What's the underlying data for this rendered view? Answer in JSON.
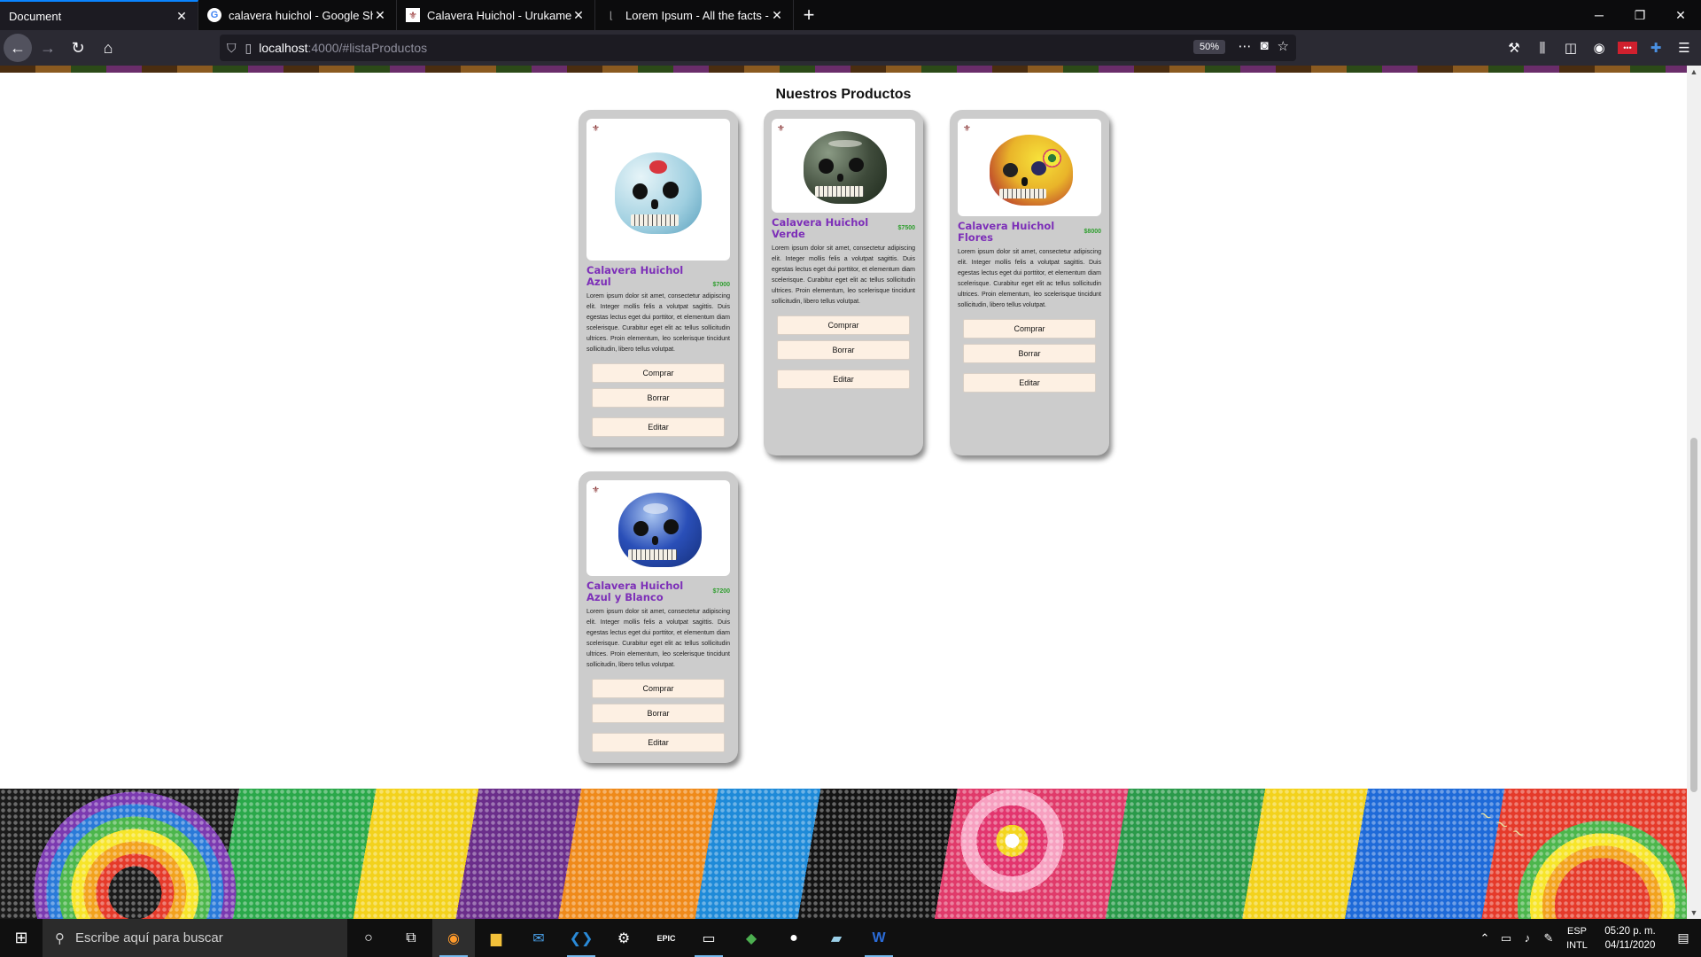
{
  "browser": {
    "tabs": [
      {
        "title": "Document",
        "active": true,
        "favicon": "none"
      },
      {
        "title": "calavera huichol - Google Shop",
        "active": false,
        "favicon": "google-icon"
      },
      {
        "title": "Calavera Huichol - Urukame | A",
        "active": false,
        "favicon": "urukame-icon"
      },
      {
        "title": "Lorem Ipsum - All the facts - Li",
        "active": false,
        "favicon": "lipsum-icon"
      }
    ],
    "url_host": "localhost",
    "url_path": ":4000/#listaProductos",
    "zoom": "50%"
  },
  "page": {
    "heading": "Nuestros Productos",
    "products": [
      {
        "name": "Calavera Huichol Azul",
        "price": "$7000",
        "description": "Lorem ipsum dolor sit amet, consectetur adipiscing elit. Integer mollis felis a volutpat sagittis. Duis egestas lectus eget dui porttitor, et elementum diam scelerisque. Curabitur eget elit ac tellus sollicitudin ultrices. Proin elementum, leo scelerisque tincidunt sollicitudin, libero tellus volutpat.",
        "colors": {
          "main": "#c9e4ef",
          "accent": "#d9363e"
        }
      },
      {
        "name": "Calavera Huichol Verde",
        "price": "$7500",
        "description": "Lorem ipsum dolor sit amet, consectetur adipiscing elit. Integer mollis felis a volutpat sagittis. Duis egestas lectus eget dui porttitor, et elementum diam scelerisque. Curabitur eget elit ac tellus sollicitudin ultrices. Proin elementum, leo scelerisque tincidunt sollicitudin, libero tellus volutpat.",
        "colors": {
          "main": "#3e4a3a",
          "accent": "#e8e8e0"
        }
      },
      {
        "name": "Calavera Huichol Flores",
        "price": "$8000",
        "description": "Lorem ipsum dolor sit amet, consectetur adipiscing elit. Integer mollis felis a volutpat sagittis. Duis egestas lectus eget dui porttitor, et elementum diam scelerisque. Curabitur eget elit ac tellus sollicitudin ultrices. Proin elementum, leo scelerisque tincidunt sollicitudin, libero tellus volutpat.",
        "colors": {
          "main": "#e9b42a",
          "accent": "#8a3aa8"
        }
      },
      {
        "name": "Calavera Huichol Azul y Blanco",
        "price": "$7200",
        "description": "Lorem ipsum dolor sit amet, consectetur adipiscing elit. Integer mollis felis a volutpat sagittis. Duis egestas lectus eget dui porttitor, et elementum diam scelerisque. Curabitur eget elit ac tellus sollicitudin ultrices. Proin elementum, leo scelerisque tincidunt sollicitudin, libero tellus volutpat.",
        "colors": {
          "main": "#2a4fb8",
          "accent": "#dfe8f6"
        }
      }
    ],
    "buttons": {
      "buy": "Comprar",
      "delete": "Borrar",
      "edit": "Editar"
    }
  },
  "taskbar": {
    "search_placeholder": "Escribe aquí para buscar",
    "lang_line1": "ESP",
    "lang_line2": "INTL",
    "time": "05:20 p. m.",
    "date": "04/11/2020"
  }
}
